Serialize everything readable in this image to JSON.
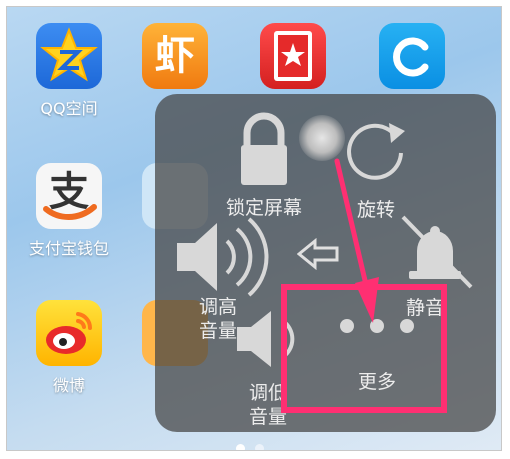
{
  "apps": [
    {
      "label": "QQ空间",
      "icon": "qq-space-icon"
    },
    {
      "label": "支付宝钱包",
      "icon": "alipay-icon"
    },
    {
      "label": "微博",
      "icon": "weibo-icon"
    },
    {
      "label": "",
      "icon": "xiami-icon"
    },
    {
      "label": "",
      "icon": "favorites-icon"
    },
    {
      "label": "",
      "icon": "refresh-app-icon"
    }
  ],
  "xia_glyph": "虾",
  "assistive_menu": {
    "lock_screen": "锁定屏幕",
    "rotate": "旋转",
    "volume_up": "调高\n音量",
    "volume_down": "调低\n音量",
    "mute": "静音",
    "more": "更多"
  },
  "annotation_color": "#ff2f72",
  "page_indicator": {
    "count": 2,
    "active": 0
  }
}
